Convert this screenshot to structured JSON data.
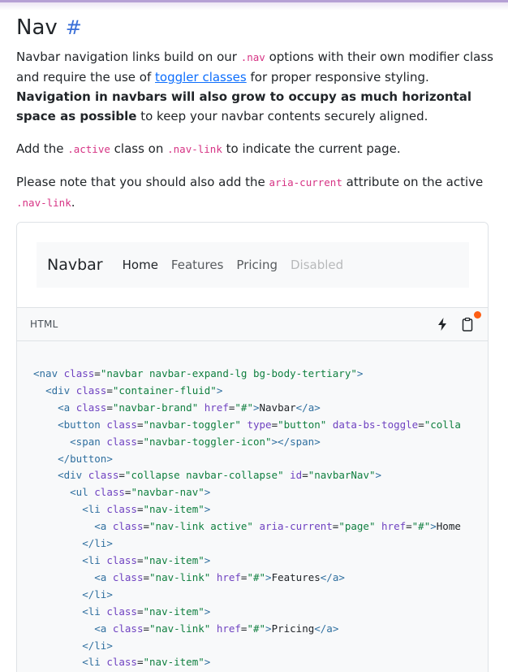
{
  "section": {
    "title": "Nav",
    "anchor": "#"
  },
  "intro": {
    "p1_a": "Navbar navigation links build on our ",
    "p1_code": ".nav",
    "p1_b": " options with their own modifier class and require the use of ",
    "p1_link": "toggler classes",
    "p1_c": " for proper responsive styling. ",
    "p1_strong": "Navigation in navbars will also grow to occupy as much horizontal space as possible",
    "p1_d": " to keep your navbar contents securely aligned.",
    "p2_a": "Add the ",
    "p2_code1": ".active",
    "p2_b": " class on ",
    "p2_code2": ".nav-link",
    "p2_c": " to indicate the current page.",
    "p3_a": "Please note that you should also add the ",
    "p3_code1": "aria-current",
    "p3_b": " attribute on the active ",
    "p3_code2": ".nav-link",
    "p3_c": "."
  },
  "preview": {
    "brand": "Navbar",
    "links": [
      "Home",
      "Features",
      "Pricing",
      "Disabled"
    ]
  },
  "code": {
    "language": "HTML",
    "lines": [
      [
        [
          "tg",
          "<nav "
        ],
        [
          "at",
          "class"
        ],
        [
          "tx",
          "="
        ],
        [
          "st",
          "\"navbar navbar-expand-lg bg-body-tertiary\""
        ],
        [
          "tg",
          ">"
        ]
      ],
      [
        [
          "tx",
          "  "
        ],
        [
          "tg",
          "<div "
        ],
        [
          "at",
          "class"
        ],
        [
          "tx",
          "="
        ],
        [
          "st",
          "\"container-fluid\""
        ],
        [
          "tg",
          ">"
        ]
      ],
      [
        [
          "tx",
          "    "
        ],
        [
          "tg",
          "<a "
        ],
        [
          "at",
          "class"
        ],
        [
          "tx",
          "="
        ],
        [
          "st",
          "\"navbar-brand\""
        ],
        [
          "tx",
          " "
        ],
        [
          "at",
          "href"
        ],
        [
          "tx",
          "="
        ],
        [
          "st",
          "\"#\""
        ],
        [
          "tg",
          ">"
        ],
        [
          "tx",
          "Navbar"
        ],
        [
          "tg",
          "</a>"
        ]
      ],
      [
        [
          "tx",
          "    "
        ],
        [
          "tg",
          "<button "
        ],
        [
          "at",
          "class"
        ],
        [
          "tx",
          "="
        ],
        [
          "st",
          "\"navbar-toggler\""
        ],
        [
          "tx",
          " "
        ],
        [
          "at",
          "type"
        ],
        [
          "tx",
          "="
        ],
        [
          "st",
          "\"button\""
        ],
        [
          "tx",
          " "
        ],
        [
          "at",
          "data-bs-toggle"
        ],
        [
          "tx",
          "="
        ],
        [
          "st",
          "\"colla"
        ]
      ],
      [
        [
          "tx",
          "      "
        ],
        [
          "tg",
          "<span "
        ],
        [
          "at",
          "class"
        ],
        [
          "tx",
          "="
        ],
        [
          "st",
          "\"navbar-toggler-icon\""
        ],
        [
          "tg",
          "></span>"
        ]
      ],
      [
        [
          "tx",
          "    "
        ],
        [
          "tg",
          "</button>"
        ]
      ],
      [
        [
          "tx",
          "    "
        ],
        [
          "tg",
          "<div "
        ],
        [
          "at",
          "class"
        ],
        [
          "tx",
          "="
        ],
        [
          "st",
          "\"collapse navbar-collapse\""
        ],
        [
          "tx",
          " "
        ],
        [
          "at",
          "id"
        ],
        [
          "tx",
          "="
        ],
        [
          "st",
          "\"navbarNav\""
        ],
        [
          "tg",
          ">"
        ]
      ],
      [
        [
          "tx",
          "      "
        ],
        [
          "tg",
          "<ul "
        ],
        [
          "at",
          "class"
        ],
        [
          "tx",
          "="
        ],
        [
          "st",
          "\"navbar-nav\""
        ],
        [
          "tg",
          ">"
        ]
      ],
      [
        [
          "tx",
          "        "
        ],
        [
          "tg",
          "<li "
        ],
        [
          "at",
          "class"
        ],
        [
          "tx",
          "="
        ],
        [
          "st",
          "\"nav-item\""
        ],
        [
          "tg",
          ">"
        ]
      ],
      [
        [
          "tx",
          "          "
        ],
        [
          "tg",
          "<a "
        ],
        [
          "at",
          "class"
        ],
        [
          "tx",
          "="
        ],
        [
          "st",
          "\"nav-link active\""
        ],
        [
          "tx",
          " "
        ],
        [
          "at",
          "aria-current"
        ],
        [
          "tx",
          "="
        ],
        [
          "st",
          "\"page\""
        ],
        [
          "tx",
          " "
        ],
        [
          "at",
          "href"
        ],
        [
          "tx",
          "="
        ],
        [
          "st",
          "\"#\""
        ],
        [
          "tg",
          ">"
        ],
        [
          "tx",
          "Home"
        ]
      ],
      [
        [
          "tx",
          "        "
        ],
        [
          "tg",
          "</li>"
        ]
      ],
      [
        [
          "tx",
          "        "
        ],
        [
          "tg",
          "<li "
        ],
        [
          "at",
          "class"
        ],
        [
          "tx",
          "="
        ],
        [
          "st",
          "\"nav-item\""
        ],
        [
          "tg",
          ">"
        ]
      ],
      [
        [
          "tx",
          "          "
        ],
        [
          "tg",
          "<a "
        ],
        [
          "at",
          "class"
        ],
        [
          "tx",
          "="
        ],
        [
          "st",
          "\"nav-link\""
        ],
        [
          "tx",
          " "
        ],
        [
          "at",
          "href"
        ],
        [
          "tx",
          "="
        ],
        [
          "st",
          "\"#\""
        ],
        [
          "tg",
          ">"
        ],
        [
          "tx",
          "Features"
        ],
        [
          "tg",
          "</a>"
        ]
      ],
      [
        [
          "tx",
          "        "
        ],
        [
          "tg",
          "</li>"
        ]
      ],
      [
        [
          "tx",
          "        "
        ],
        [
          "tg",
          "<li "
        ],
        [
          "at",
          "class"
        ],
        [
          "tx",
          "="
        ],
        [
          "st",
          "\"nav-item\""
        ],
        [
          "tg",
          ">"
        ]
      ],
      [
        [
          "tx",
          "          "
        ],
        [
          "tg",
          "<a "
        ],
        [
          "at",
          "class"
        ],
        [
          "tx",
          "="
        ],
        [
          "st",
          "\"nav-link\""
        ],
        [
          "tx",
          " "
        ],
        [
          "at",
          "href"
        ],
        [
          "tx",
          "="
        ],
        [
          "st",
          "\"#\""
        ],
        [
          "tg",
          ">"
        ],
        [
          "tx",
          "Pricing"
        ],
        [
          "tg",
          "</a>"
        ]
      ],
      [
        [
          "tx",
          "        "
        ],
        [
          "tg",
          "</li>"
        ]
      ],
      [
        [
          "tx",
          "        "
        ],
        [
          "tg",
          "<li "
        ],
        [
          "at",
          "class"
        ],
        [
          "tx",
          "="
        ],
        [
          "st",
          "\"nav-item\""
        ],
        [
          "tg",
          ">"
        ]
      ]
    ]
  },
  "icons": {
    "copy": "clipboard-icon",
    "edit": "lightning-icon"
  },
  "colors": {
    "accent": "#7952b3",
    "code_pink": "#d63384",
    "link_blue": "#0d6efd",
    "notify_dot": "#fd5e14"
  }
}
